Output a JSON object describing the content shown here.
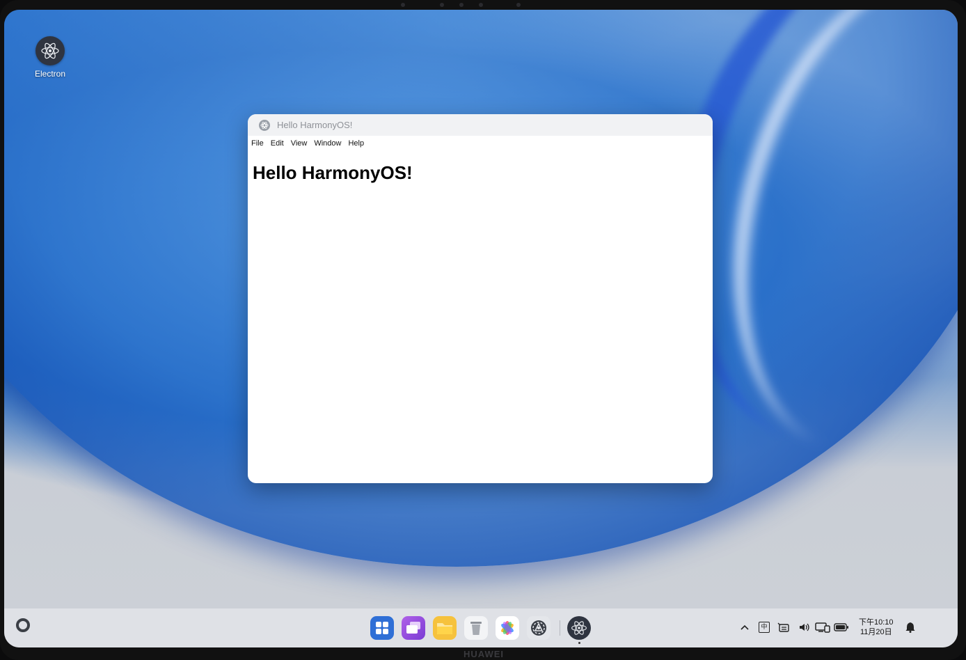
{
  "desktop": {
    "icons": [
      {
        "label": "Electron",
        "icon": "electron-icon"
      }
    ]
  },
  "window": {
    "title": "Hello HarmonyOS!",
    "menu": [
      "File",
      "Edit",
      "View",
      "Window",
      "Help"
    ],
    "heading": "Hello HarmonyOS!"
  },
  "taskbar": {
    "dock_apps": [
      "app-center-icon",
      "multitask-icon",
      "files-icon",
      "trash-icon",
      "gallery-icon",
      "settings-icon",
      "electron-icon"
    ],
    "tray": {
      "input_method": "中",
      "clock_time": "下午10:10",
      "clock_date": "11月20日"
    }
  },
  "device": {
    "brand": "HUAWEI"
  },
  "colors": {
    "accent_blue": "#2f6fd6",
    "window_bg": "#ffffff",
    "titlebar_bg": "#f1f2f4",
    "taskbar_bg": "#e0e2e6"
  }
}
